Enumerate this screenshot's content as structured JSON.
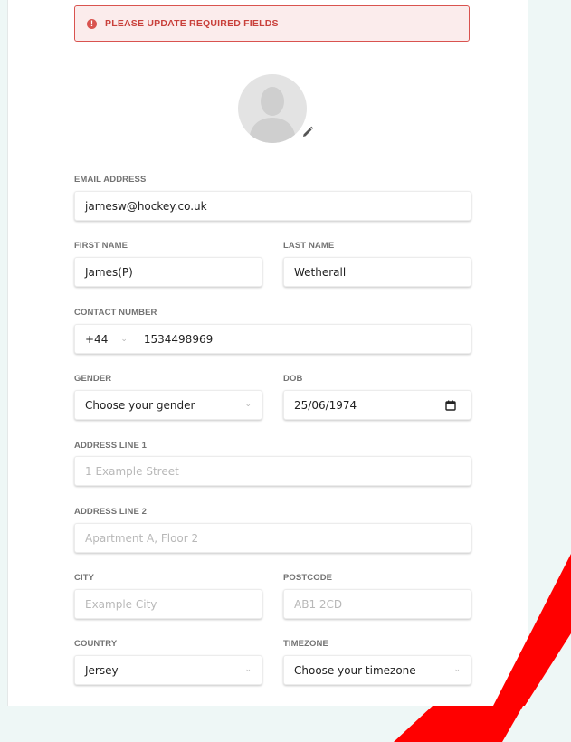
{
  "alert": {
    "icon": "info-icon",
    "text": "PLEASE UPDATE REQUIRED FIELDS"
  },
  "avatar": {
    "icon": "user-avatar-icon",
    "edit_icon": "pencil-icon"
  },
  "email": {
    "label": "EMAIL ADDRESS",
    "value": "jamesw@hockey.co.uk"
  },
  "first_name": {
    "label": "FIRST NAME",
    "value": "James(P)"
  },
  "last_name": {
    "label": "LAST NAME",
    "value": "Wetherall"
  },
  "contact": {
    "label": "CONTACT NUMBER",
    "code": "+44",
    "number": "1534498969"
  },
  "gender": {
    "label": "GENDER",
    "value": "Choose your gender"
  },
  "dob": {
    "label": "DOB",
    "value": "25/06/1974",
    "icon": "calendar-icon"
  },
  "address1": {
    "label": "ADDRESS LINE 1",
    "placeholder": "1 Example Street"
  },
  "address2": {
    "label": "ADDRESS LINE 2",
    "placeholder": "Apartment A, Floor 2"
  },
  "city": {
    "label": "CITY",
    "placeholder": "Example City"
  },
  "postcode": {
    "label": "POSTCODE",
    "placeholder": "AB1 2CD"
  },
  "country": {
    "label": "COUNTRY",
    "value": "Jersey"
  },
  "timezone": {
    "label": "TIMEZONE",
    "value": "Choose your timezone"
  },
  "colors": {
    "alert_border": "#d9534f",
    "alert_bg": "#fbecec",
    "background": "#eef7f6",
    "decor_red": "#ff0000"
  }
}
